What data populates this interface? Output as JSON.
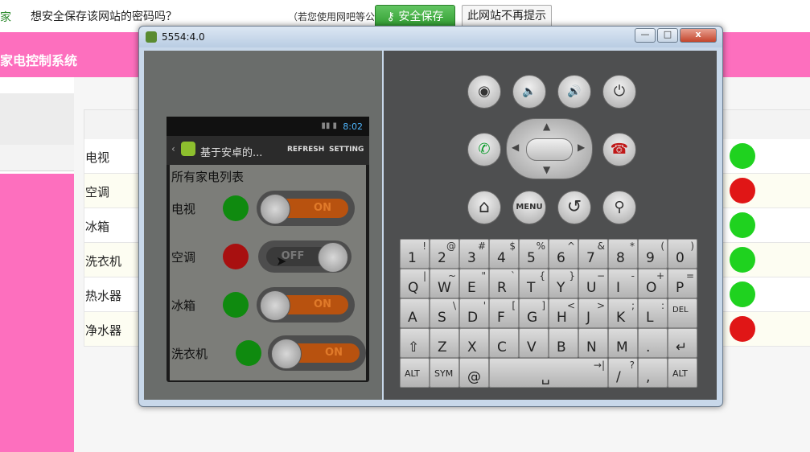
{
  "password_bar": {
    "prev_text": "家",
    "question": "想安全保存该网站的密码吗？",
    "hint": "（若您使用网吧等公共电脑不建议保存）",
    "save_label": "安全保存",
    "never_label": "此网站不再提示"
  },
  "page": {
    "title": "家电控制系统",
    "devices": [
      {
        "name": "电视",
        "status_color": "#1fd21f"
      },
      {
        "name": "空调",
        "status_color": "#e01616"
      },
      {
        "name": "冰箱",
        "status_color": "#1fd21f"
      },
      {
        "name": "洗衣机",
        "status_color": "#1fd21f"
      },
      {
        "name": "热水器",
        "status_color": "#1fd21f"
      },
      {
        "name": "净水器",
        "status_color": "#e01616"
      }
    ]
  },
  "emulator": {
    "window_title": "5554:4.0",
    "window_buttons": [
      "—",
      "□",
      "x"
    ],
    "phone": {
      "time": "8:02",
      "app_title": "基于安卓的...",
      "action_refresh": "REFRESH",
      "action_setting": "SETTING",
      "list_title": "所有家电列表",
      "devices": [
        {
          "name": "电视",
          "dot_color": "#0f8a0f",
          "toggle": "ON"
        },
        {
          "name": "空调",
          "dot_color": "#a81010",
          "toggle": "OFF"
        },
        {
          "name": "冰箱",
          "dot_color": "#0f8a0f",
          "toggle": "ON"
        },
        {
          "name": "洗衣机",
          "dot_color": "#0f8a0f",
          "toggle": "ON"
        }
      ]
    },
    "control_buttons": {
      "camera": "◉",
      "volume_down": "🔈",
      "volume_up": "🔊",
      "power": "⏻",
      "call": "✆",
      "end_call": "☎",
      "home": "⌂",
      "menu": "MENU",
      "back": "↺",
      "search": "⚲"
    },
    "keyboard": {
      "rows": [
        [
          [
            "1",
            "!"
          ],
          [
            "2",
            "@"
          ],
          [
            "3",
            "#"
          ],
          [
            "4",
            "$"
          ],
          [
            "5",
            "%"
          ],
          [
            "6",
            "^"
          ],
          [
            "7",
            "&"
          ],
          [
            "8",
            "*"
          ],
          [
            "9",
            "("
          ],
          [
            "0",
            ")"
          ]
        ],
        [
          [
            "Q",
            "|"
          ],
          [
            "W",
            "~"
          ],
          [
            "E",
            "\""
          ],
          [
            "R",
            "`"
          ],
          [
            "T",
            "{"
          ],
          [
            "Y",
            "}"
          ],
          [
            "U",
            "−"
          ],
          [
            "I",
            "-"
          ],
          [
            "O",
            "+"
          ],
          [
            "P",
            "="
          ]
        ],
        [
          [
            "A",
            ""
          ],
          [
            "S",
            "\\"
          ],
          [
            "D",
            "'"
          ],
          [
            "F",
            "["
          ],
          [
            "G",
            "]"
          ],
          [
            "H",
            "<"
          ],
          [
            "J",
            ">"
          ],
          [
            "K",
            ";"
          ],
          [
            "L",
            ":"
          ],
          [
            "DEL",
            ""
          ]
        ],
        [
          [
            "⇧",
            ""
          ],
          [
            "Z",
            ""
          ],
          [
            "X",
            ""
          ],
          [
            "C",
            ""
          ],
          [
            "V",
            ""
          ],
          [
            "B",
            ""
          ],
          [
            "N",
            ""
          ],
          [
            "M",
            ""
          ],
          [
            ".",
            ""
          ],
          [
            "↵",
            ""
          ]
        ]
      ],
      "bottom_row": [
        [
          "ALT",
          ""
        ],
        [
          "SYM",
          ""
        ],
        [
          "@",
          ""
        ],
        [
          "␣",
          "→|"
        ],
        [
          "/",
          "?"
        ],
        [
          ",",
          ""
        ],
        [
          "ALT",
          ""
        ]
      ]
    }
  }
}
